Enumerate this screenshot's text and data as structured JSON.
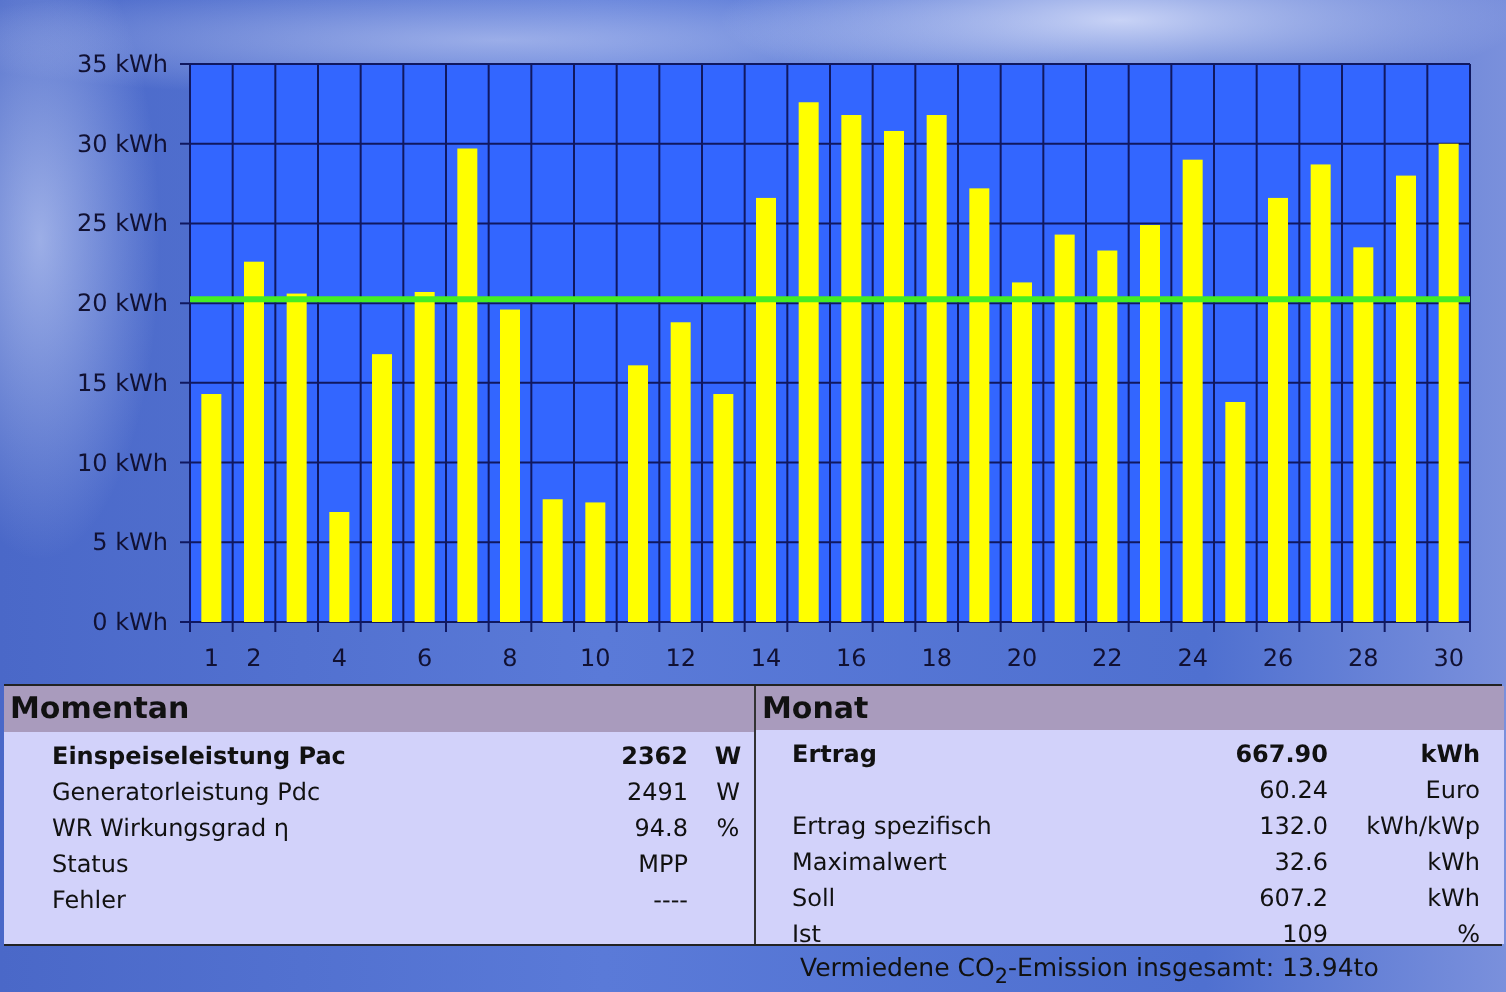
{
  "chart": {
    "chart_data": {
      "type": "bar",
      "x": [
        1,
        2,
        3,
        4,
        5,
        6,
        7,
        8,
        9,
        10,
        11,
        12,
        13,
        14,
        15,
        16,
        17,
        18,
        19,
        20,
        21,
        22,
        23,
        24,
        25,
        26,
        27,
        28,
        29,
        30
      ],
      "xlim": [
        0.5,
        30.5
      ],
      "grid": true,
      "values": [
        14.3,
        22.6,
        20.6,
        6.9,
        16.8,
        20.7,
        29.7,
        19.6,
        7.7,
        7.5,
        16.1,
        18.8,
        14.3,
        26.6,
        32.6,
        31.8,
        30.8,
        31.8,
        27.2,
        21.3,
        24.3,
        23.3,
        24.9,
        29.0,
        13.8,
        26.6,
        28.7,
        23.5,
        28.0,
        30.0
      ],
      "ylim": [
        0,
        35
      ],
      "yticks": [
        {
          "value": 0,
          "label": "0 kWh"
        },
        {
          "value": 5,
          "label": "5 kWh"
        },
        {
          "value": 10,
          "label": "10 kWh"
        },
        {
          "value": 15,
          "label": "15 kWh"
        },
        {
          "value": 20,
          "label": "20 kWh"
        },
        {
          "value": 25,
          "label": "25 kWh"
        },
        {
          "value": 30,
          "label": "30 kWh"
        },
        {
          "value": 35,
          "label": "35 kWh"
        }
      ],
      "xticks": [
        1,
        2,
        4,
        6,
        8,
        10,
        12,
        14,
        16,
        18,
        20,
        22,
        24,
        26,
        28,
        30
      ],
      "ref_lines": [
        {
          "axis": "y",
          "value": 20.24,
          "color": "#44ee22"
        }
      ]
    }
  },
  "momentan": {
    "title": "Momentan",
    "rows": [
      {
        "label": "Einspeiseleistung Pac",
        "value": "2362",
        "unit": "W",
        "bold": true
      },
      {
        "label": "Generatorleistung Pdc",
        "value": "2491",
        "unit": "W",
        "bold": false
      },
      {
        "label": "WR Wirkungsgrad η",
        "value": "94.8",
        "unit": "%",
        "bold": false
      },
      {
        "label": "Status",
        "value": "MPP",
        "bold": false
      },
      {
        "label": "Fehler",
        "value": "----",
        "bold": false
      }
    ]
  },
  "monat": {
    "title": "Monat",
    "rows": [
      {
        "label": "Ertrag",
        "value": "667.90",
        "unit": "kWh",
        "bold": true
      },
      {
        "value": "60.24",
        "unit": "Euro",
        "bold": false
      },
      {
        "label": "Ertrag spezifisch",
        "value": "132.0",
        "unit": "kWh/kWp",
        "bold": false
      },
      {
        "label": "Maximalwert",
        "value": "32.6",
        "unit": "kWh",
        "bold": false
      },
      {
        "label": "Soll",
        "value": "607.2",
        "unit": "kWh",
        "bold": false
      },
      {
        "label": "Ist",
        "value": "109",
        "unit": "%",
        "bold": false
      }
    ]
  },
  "footer": "Vermiedene CO$_{2}$-Emission insgesamt: 13.94to"
}
